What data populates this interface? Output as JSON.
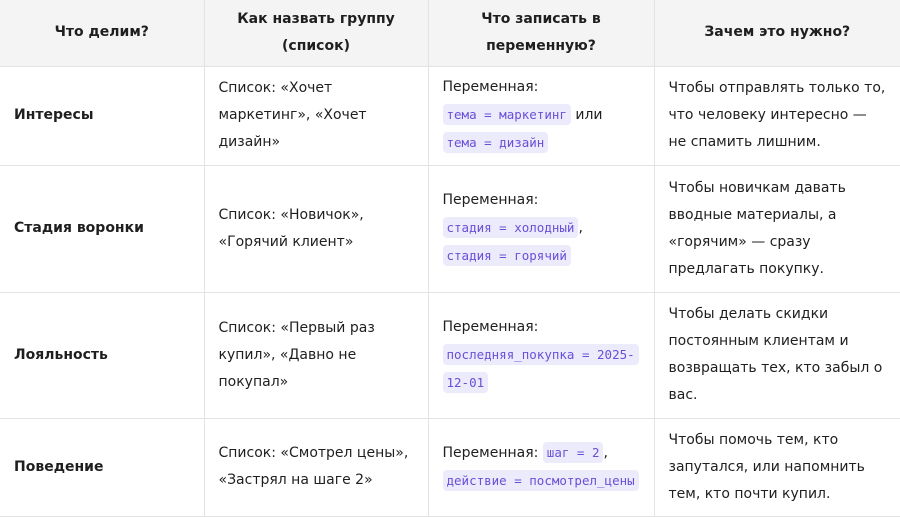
{
  "headers": {
    "what": "Что делим?",
    "name": "Как назвать группу (список)",
    "variable": "Что записать в переменную?",
    "why": "Зачем это нужно?"
  },
  "rows": [
    {
      "category": "Интересы",
      "list": "Список: «Хочет маркетинг», «Хочет дизайн»",
      "var_label": "Переменная:",
      "code1": "тема = маркетинг",
      "sep": " или ",
      "code2": "тема = дизайн",
      "why": "Чтобы отправлять только то, что человеку интересно — не спамить лишним."
    },
    {
      "category": "Стадия воронки",
      "list": "Список: «Новичок», «Горячий клиент»",
      "var_label": "Переменная:",
      "code1": "стадия = холодный",
      "sep": ",",
      "code2": "стадия = горячий",
      "why": "Чтобы новичкам давать вводные материалы, а «горячим» — сразу предлагать покупку."
    },
    {
      "category": "Лояльность",
      "list": "Список: «Первый раз купил», «Давно не покупал»",
      "var_label": "Переменная:",
      "code1": "последняя_покупка = 2025-12-01",
      "why": "Чтобы делать скидки постоянным клиентам и возвращать тех, кто забыл о вас."
    },
    {
      "category": "Поведение",
      "list": "Список: «Смотрел цены», «Застрял на шаге 2»",
      "var_label": "Переменная:",
      "code1": "шаг = 2",
      "sep": ",",
      "code2": "действие = посмотрел_цены",
      "why": "Чтобы помочь тем, кто запутался, или напомнить тем, кто почти купил."
    }
  ]
}
